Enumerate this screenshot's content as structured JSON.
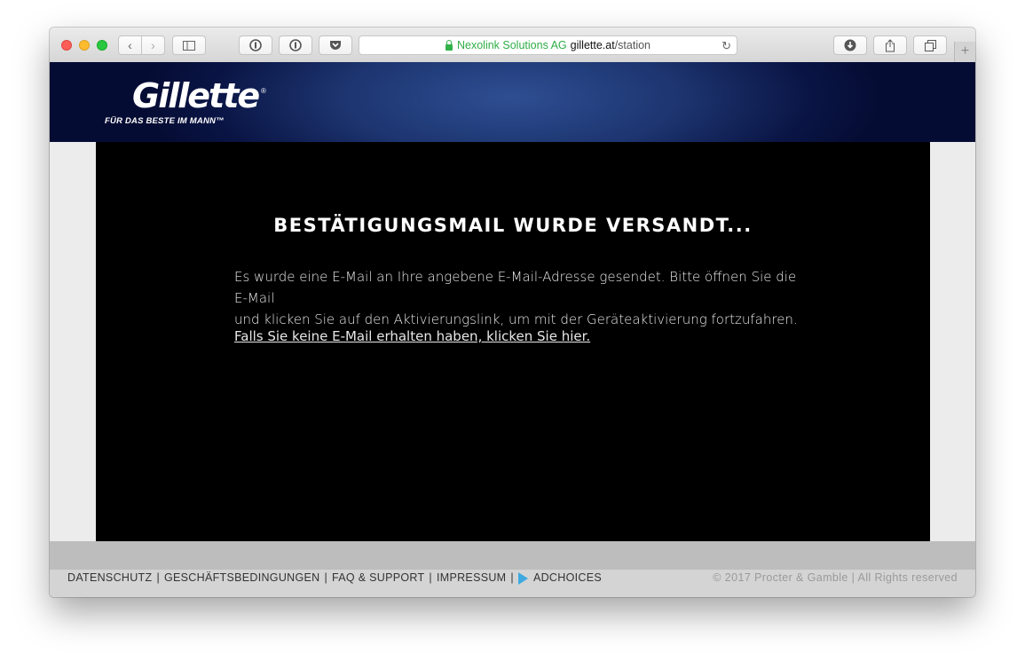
{
  "browser": {
    "url_ev_org": "Nexolink Solutions AG",
    "url_host": "gillette.at",
    "url_path": "/station"
  },
  "header": {
    "brand": "Gillette",
    "tagline": "FÜR DAS BESTE IM MANN™"
  },
  "main": {
    "title": "BESTÄTIGUNGSMAIL WURDE VERSANDT...",
    "message_line1": "Es wurde eine E-Mail an Ihre angebene E-Mail-Adresse gesendet. Bitte öffnen Sie die E-Mail",
    "message_line2": "und klicken Sie auf den Aktivierungslink, um mit der Geräteaktivierung fortzufahren.",
    "resend_link": "Falls Sie keine E-Mail erhalten haben, klicken Sie hier."
  },
  "footer": {
    "links": [
      "DATENSCHUTZ",
      "GESCHÄFTSBEDINGUNGEN",
      "FAQ & SUPPORT",
      "IMPRESSUM",
      "ADCHOICES"
    ],
    "copyright": "© 2017 Procter & Gamble | All Rights reserved"
  },
  "colors": {
    "ev_green": "#2eae47",
    "header_blue": "#1d3570",
    "panel_black": "#000000",
    "adchoices_blue": "#3fa9e0"
  }
}
